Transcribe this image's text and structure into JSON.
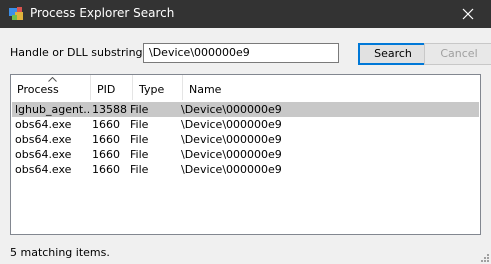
{
  "window": {
    "title": "Process Explorer Search"
  },
  "form": {
    "label": "Handle or DLL substring:",
    "input_value": "\\Device\\000000e9",
    "search_label": "Search",
    "cancel_label": "Cancel"
  },
  "table": {
    "columns": [
      "Process",
      "PID",
      "Type",
      "Name"
    ],
    "rows": [
      {
        "process": "lghub_agent...",
        "pid": "13588",
        "type": "File",
        "name": "\\Device\\000000e9"
      },
      {
        "process": "obs64.exe",
        "pid": "1660",
        "type": "File",
        "name": "\\Device\\000000e9"
      },
      {
        "process": "obs64.exe",
        "pid": "1660",
        "type": "File",
        "name": "\\Device\\000000e9"
      },
      {
        "process": "obs64.exe",
        "pid": "1660",
        "type": "File",
        "name": "\\Device\\000000e9"
      },
      {
        "process": "obs64.exe",
        "pid": "1660",
        "type": "File",
        "name": "\\Device\\000000e9"
      }
    ]
  },
  "status": {
    "text": "5 matching items."
  },
  "colors": {
    "titlebar": "#333333",
    "selected_row": "#c8c8c8",
    "accent": "#0078d7"
  }
}
